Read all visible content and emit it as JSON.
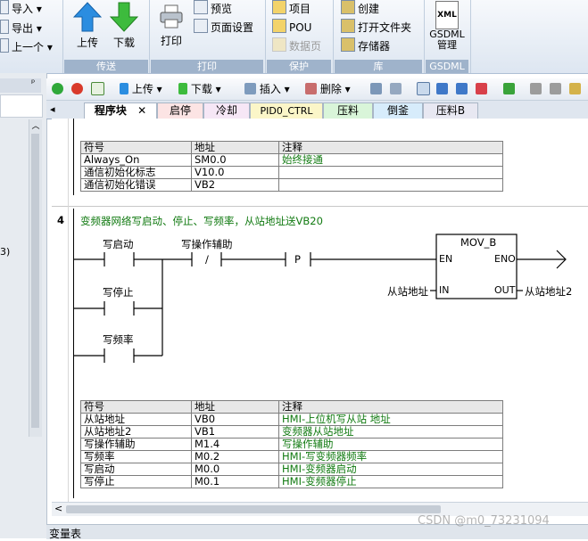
{
  "ribbon": {
    "import_label": "导入",
    "export_label": "导出",
    "prev_label": "上一个",
    "upload_label": "上传",
    "download_label": "下载",
    "transfer_group": "传送",
    "print_label": "打印",
    "preview_label": "预览",
    "page_setup_label": "页面设置",
    "print_group": "打印",
    "project_label": "项目",
    "pou_label": "POU",
    "data_page_label": "数据页",
    "protect_group": "保护",
    "create_label": "创建",
    "open_folder_label": "打开文件夹",
    "storage_label": "存储器",
    "library_group": "库",
    "gsdml_icon_text": "XML",
    "gsdml_label_line1": "GSDML",
    "gsdml_label_line2": "管理",
    "gsdml_group": "GSDML"
  },
  "left_pane": {
    "partial_text": "3)"
  },
  "toolbar": {
    "upload_label": "上传",
    "download_label": "下载",
    "insert_label": "插入",
    "delete_label": "删除"
  },
  "tabs": [
    {
      "label": "程序块",
      "active": true
    },
    {
      "label": "启停",
      "color": "#fce4e4"
    },
    {
      "label": "冷却",
      "color": "#f6e7f6"
    },
    {
      "label": "PID0_CTRL",
      "color": "#fbf6c8"
    },
    {
      "label": "压料",
      "color": "#d9f5d9"
    },
    {
      "label": "倒釜",
      "color": "#d7ecfb"
    },
    {
      "label": "压料B",
      "color": "#e8e8f2"
    }
  ],
  "table1": {
    "headers": [
      "符号",
      "地址",
      "注释"
    ],
    "rows": [
      [
        "Always_On",
        "SM0.0",
        "始终接通"
      ],
      [
        "通信初始化标志",
        "V10.0",
        ""
      ],
      [
        "通信初始化错误",
        "VB2",
        ""
      ]
    ]
  },
  "network4": {
    "number": "4",
    "title": "变频器网络写启动、停止、写频率，从站地址送VB20",
    "contact1": "写启动",
    "contact2": "写停止",
    "contact3": "写频率",
    "contact4": "写操作辅助",
    "neg_symbol": "/",
    "p_symbol": "P",
    "box_title": "MOV_B",
    "en": "EN",
    "eno": "ENO",
    "in_pin": "IN",
    "out_pin": "OUT",
    "in_operand": "从站地址",
    "out_operand": "从站地址2"
  },
  "table2": {
    "headers": [
      "符号",
      "地址",
      "注释"
    ],
    "rows": [
      [
        "从站地址",
        "VB0",
        "HMI-上位机写从站 地址"
      ],
      [
        "从站地址2",
        "VB1",
        "变频器从站地址"
      ],
      [
        "写操作辅助",
        "M1.4",
        "写操作辅助"
      ],
      [
        "写频率",
        "M0.2",
        "HMI-写变频器频率"
      ],
      [
        "写启动",
        "M0.0",
        "HMI-变频器启动"
      ],
      [
        "写停止",
        "M0.1",
        "HMI-变频器停止"
      ]
    ]
  },
  "status_bar": {
    "label": "变量表"
  },
  "watermark": "CSDN @m0_73231094"
}
